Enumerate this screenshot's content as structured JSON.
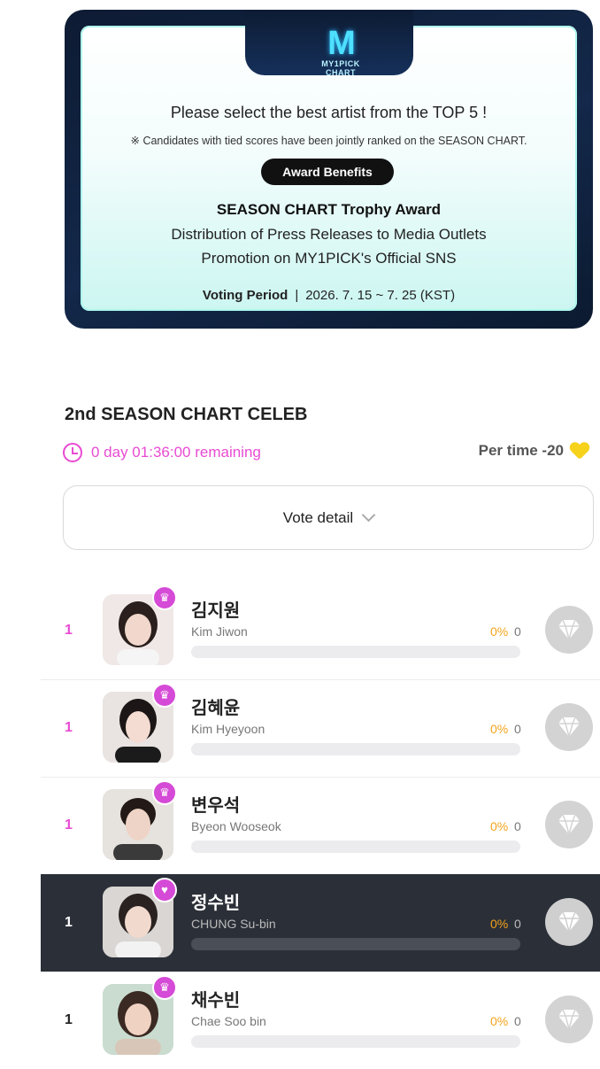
{
  "banner": {
    "logo_mark": "M",
    "logo_text": "MY1PICK CHART",
    "headline": "Please select the best artist from the TOP 5 !",
    "note": "※ Candidates with tied scores have been jointly ranked on the SEASON CHART.",
    "benefit_label": "Award Benefits",
    "benefit_line1": "SEASON CHART Trophy Award",
    "benefit_line2": "Distribution of Press Releases to Media Outlets",
    "benefit_line3": "Promotion on MY1PICK's Official SNS",
    "period_label": "Voting Period",
    "period_separator": "|",
    "period_value": "2026. 7. 15 ~ 7. 25 (KST)"
  },
  "section": {
    "title": "2nd SEASON CHART CELEB",
    "remaining": "0 day 01:36:00 remaining",
    "per_time": "Per time -20",
    "vote_detail": "Vote detail"
  },
  "colors": {
    "accent": "#e84bd2",
    "percent": "#f3a31b",
    "heart": "#f6d21a",
    "active_row": "#2b2f38"
  },
  "rows": [
    {
      "rank": "1",
      "name_ko": "김지원",
      "name_en": "Kim Jiwon",
      "percent": "0%",
      "count": "0",
      "progress": 0,
      "badge": "crown-icon"
    },
    {
      "rank": "1",
      "name_ko": "김혜윤",
      "name_en": "Kim Hyeyoon",
      "percent": "0%",
      "count": "0",
      "progress": 0,
      "badge": "crown-icon"
    },
    {
      "rank": "1",
      "name_ko": "변우석",
      "name_en": "Byeon Wooseok",
      "percent": "0%",
      "count": "0",
      "progress": 0,
      "badge": "crown-icon"
    },
    {
      "rank": "1",
      "name_ko": "정수빈",
      "name_en": "CHUNG Su-bin",
      "percent": "0%",
      "count": "0",
      "progress": 0,
      "badge": "heart-icon"
    },
    {
      "rank": "1",
      "name_ko": "채수빈",
      "name_en": "Chae Soo bin",
      "percent": "0%",
      "count": "0",
      "progress": 0,
      "badge": "crown-icon"
    }
  ]
}
